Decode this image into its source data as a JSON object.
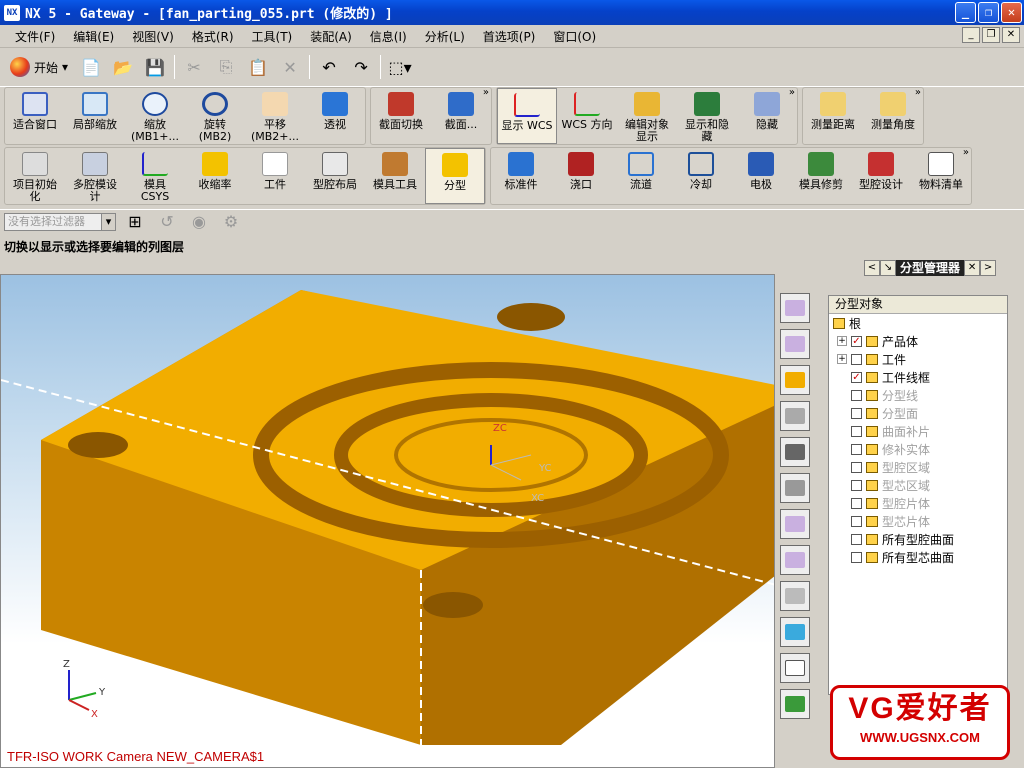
{
  "title": "NX 5 - Gateway - [fan_parting_055.prt  (修改的) ]",
  "menu": [
    "文件(F)",
    "编辑(E)",
    "视图(V)",
    "格式(R)",
    "工具(T)",
    "装配(A)",
    "信息(I)",
    "分析(L)",
    "首选项(P)",
    "窗口(O)"
  ],
  "start_label": "开始",
  "view_group": [
    "适合窗口",
    "局部缩放",
    "缩放\n(MB1+...",
    "旋转\n(MB2)",
    "平移\n(MB2+...",
    "透视"
  ],
  "section_group": [
    "截面切换",
    "截面..."
  ],
  "wcs_group": [
    "显示 WCS",
    "WCS 方向",
    "编辑对象\n显示",
    "显示和隐\n藏",
    "隐藏"
  ],
  "measure_group": [
    "测量距离",
    "测量角度"
  ],
  "mold_group": [
    "项目初始\n化",
    "多腔模设\n计",
    "模具\nCSYS",
    "收缩率",
    "工件",
    "型腔布局",
    "模具工具",
    "分型"
  ],
  "mold_group2": [
    "标准件",
    "浇口",
    "流道",
    "冷却",
    "电极",
    "模具修剪",
    "型腔设计",
    "物料清单"
  ],
  "filter_placeholder": "没有选择过滤器",
  "status": "切换以显示或选择要编辑的列图层",
  "view_label": "TFR-ISO WORK Camera NEW_CAMERA$1",
  "panel_title": "分型管理器",
  "tree_header": "分型对象",
  "tree": [
    {
      "label": "根",
      "level": 0,
      "exp": false,
      "cb": null,
      "dim": false
    },
    {
      "label": "产品体",
      "level": 1,
      "exp": true,
      "cb": true,
      "dim": false
    },
    {
      "label": "工件",
      "level": 1,
      "exp": true,
      "cb": false,
      "dim": false
    },
    {
      "label": "工件线框",
      "level": 1,
      "exp": false,
      "cb": true,
      "dim": false
    },
    {
      "label": "分型线",
      "level": 1,
      "exp": false,
      "cb": false,
      "dim": true
    },
    {
      "label": "分型面",
      "level": 1,
      "exp": false,
      "cb": false,
      "dim": true
    },
    {
      "label": "曲面补片",
      "level": 1,
      "exp": false,
      "cb": false,
      "dim": true
    },
    {
      "label": "修补实体",
      "level": 1,
      "exp": false,
      "cb": false,
      "dim": true
    },
    {
      "label": "型腔区域",
      "level": 1,
      "exp": false,
      "cb": false,
      "dim": true
    },
    {
      "label": "型芯区域",
      "level": 1,
      "exp": false,
      "cb": false,
      "dim": true
    },
    {
      "label": "型腔片体",
      "level": 1,
      "exp": false,
      "cb": false,
      "dim": true
    },
    {
      "label": "型芯片体",
      "level": 1,
      "exp": false,
      "cb": false,
      "dim": true
    },
    {
      "label": "所有型腔曲面",
      "level": 1,
      "exp": false,
      "cb": false,
      "dim": false
    },
    {
      "label": "所有型芯曲面",
      "level": 1,
      "exp": false,
      "cb": false,
      "dim": false
    }
  ],
  "watermark_1": "VG爱好者",
  "watermark_2": "WWW.UGSNX.COM",
  "axis_labels": {
    "zc": "ZC",
    "yc": "YC",
    "xc": "XC",
    "z": "Z",
    "y": "Y",
    "x": "X"
  },
  "colors": {
    "part": "#f2ad00",
    "part_side": "#c98400",
    "title": "#0a4fe0",
    "accent": "#d30000"
  }
}
